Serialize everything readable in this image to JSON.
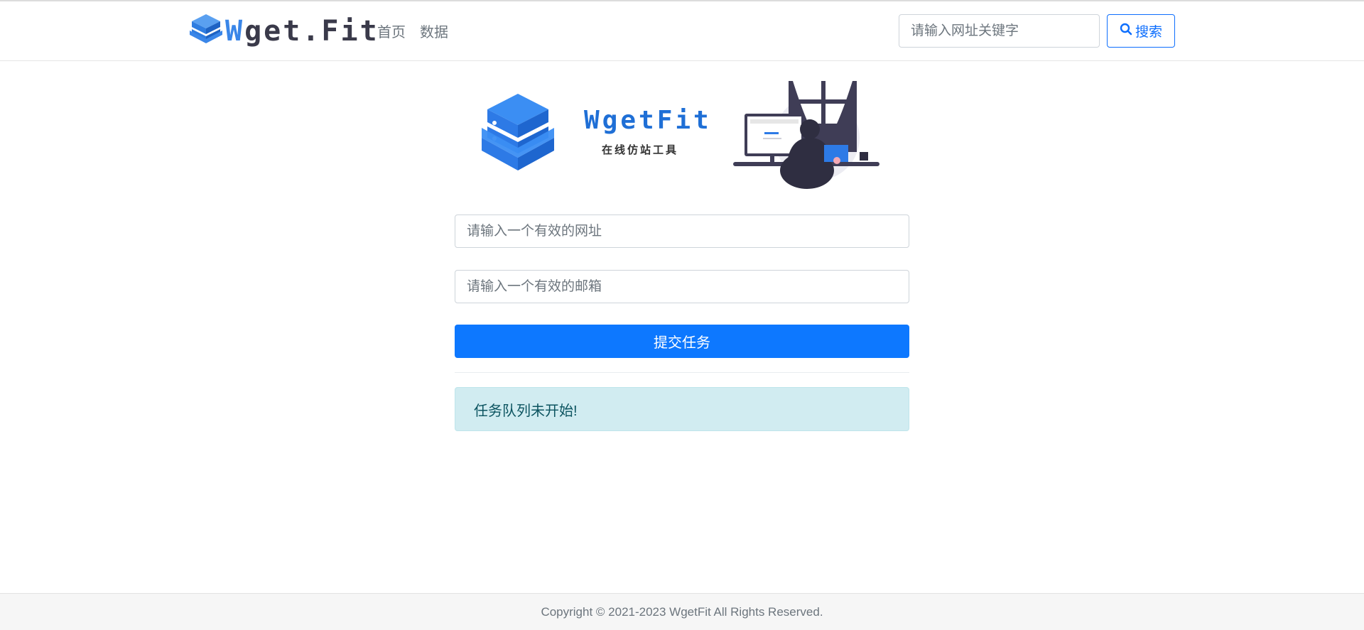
{
  "brand": {
    "logo_icon": "server-stack-icon",
    "first_letter": "W",
    "rest": "get.Fit",
    "color": "#3a86e8"
  },
  "nav": {
    "items": [
      {
        "label": "首页"
      },
      {
        "label": "数据"
      }
    ]
  },
  "search": {
    "placeholder": "请输入网址关键字",
    "button_label": "搜索",
    "icon": "search-icon"
  },
  "hero": {
    "logo_icon": "server-stack-icon",
    "title": "WgetFit",
    "subtitle": "在线仿站工具",
    "illustration": "person-at-desk-illustration"
  },
  "form": {
    "url_placeholder": "请输入一个有效的网址",
    "email_placeholder": "请输入一个有效的邮箱",
    "submit_label": "提交任务",
    "accent": "#0d78ff"
  },
  "status": {
    "message": "任务队列未开始!"
  },
  "footer": {
    "copyright": "Copyright © 2021-2023 WgetFit All Rights Reserved."
  }
}
